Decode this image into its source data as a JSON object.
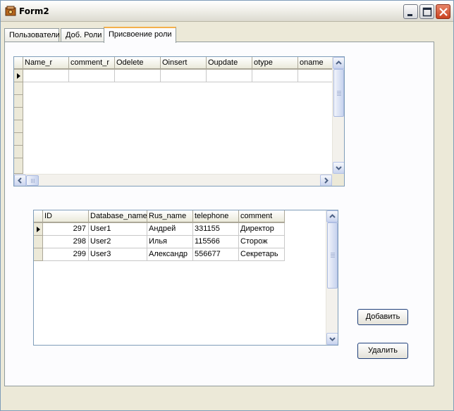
{
  "window": {
    "title": "Form2"
  },
  "tabs": [
    {
      "label": "Пользователи"
    },
    {
      "label": "Доб. Роли"
    },
    {
      "label": "Присвоение роли"
    }
  ],
  "roles_grid": {
    "columns": [
      "Name_r",
      "comment_r",
      "Odelete",
      "Oinsert",
      "Oupdate",
      "otype",
      "oname"
    ]
  },
  "users_grid": {
    "columns": [
      "ID",
      "Database_name",
      "Rus_name",
      "telephone",
      "comment"
    ],
    "rows": [
      {
        "id": "297",
        "database_name": "User1",
        "rus_name": "Андрей",
        "telephone": "331155",
        "comment": "Директор"
      },
      {
        "id": "298",
        "database_name": "User2",
        "rus_name": "Илья",
        "telephone": "115566",
        "comment": "Сторож"
      },
      {
        "id": "299",
        "database_name": "User3",
        "rus_name": "Александр",
        "telephone": "556677",
        "comment": "Секретарь"
      }
    ]
  },
  "buttons": {
    "add": "Добавить",
    "delete": "Удалить"
  }
}
